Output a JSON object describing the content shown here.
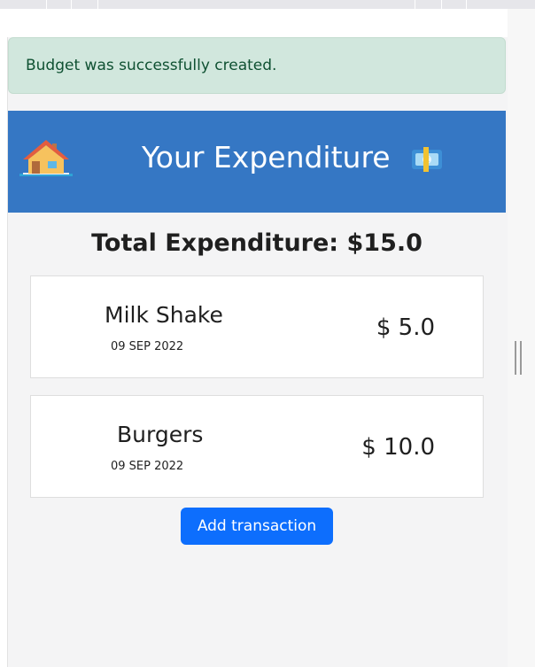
{
  "alert": {
    "message": "Budget was successfully created."
  },
  "header": {
    "title": "Your Expenditure",
    "left_icon": "house-icon",
    "right_icon": "euro-banknote-icon"
  },
  "summary": {
    "total_text": "Total Expenditure: $15.0"
  },
  "transactions": [
    {
      "name": "Milk Shake",
      "date": "09 SEP 2022",
      "amount": "$ 5.0"
    },
    {
      "name": "Burgers",
      "date": "09 SEP 2022",
      "amount": "$ 10.0"
    }
  ],
  "actions": {
    "add_transaction_label": "Add transaction"
  },
  "colors": {
    "alert_bg": "#d1e7dd",
    "alert_text": "#0f5132",
    "header_bg": "#3577c4",
    "button_bg": "#0d6efd"
  }
}
